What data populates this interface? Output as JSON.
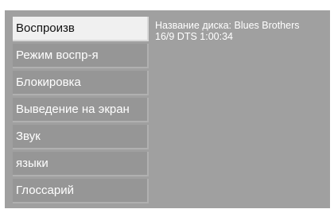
{
  "menu": {
    "items": [
      {
        "label": "Воспроизв",
        "selected": true
      },
      {
        "label": "Режим воспр-я",
        "selected": false
      },
      {
        "label": "Блокировка",
        "selected": false
      },
      {
        "label": "Выведение на экран",
        "selected": false
      },
      {
        "label": "Звук",
        "selected": false
      },
      {
        "label": "языки",
        "selected": false
      },
      {
        "label": "Глоссарий",
        "selected": false
      }
    ]
  },
  "info": {
    "disc_name": "Название диска: Blues Brothers",
    "format_line": "16/9 DTS 1:00:34"
  },
  "colors": {
    "panel": "#a0a0a0",
    "item": "#969696",
    "selected_item": "#f0f0f0",
    "text": "#ffffff",
    "selected_text": "#111111"
  }
}
